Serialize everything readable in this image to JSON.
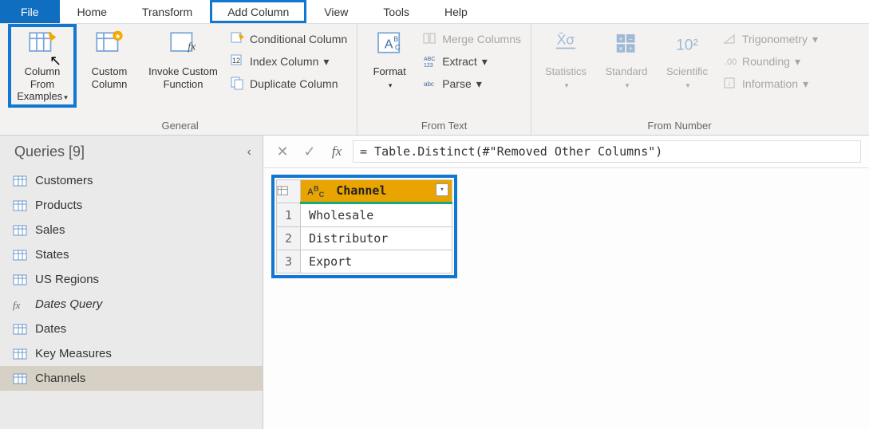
{
  "menu": {
    "file": "File",
    "home": "Home",
    "transform": "Transform",
    "add_column": "Add Column",
    "view": "View",
    "tools": "Tools",
    "help": "Help"
  },
  "ribbon": {
    "general": {
      "label": "General",
      "column_from_examples": "Column From Examples",
      "custom_column": "Custom Column",
      "invoke_custom_function": "Invoke Custom Function",
      "conditional_column": "Conditional Column",
      "index_column": "Index Column",
      "duplicate_column": "Duplicate Column"
    },
    "from_text": {
      "label": "From Text",
      "format": "Format",
      "merge_columns": "Merge Columns",
      "extract": "Extract",
      "parse": "Parse"
    },
    "from_number": {
      "label": "From Number",
      "statistics": "Statistics",
      "standard": "Standard",
      "scientific": "Scientific",
      "trigonometry": "Trigonometry",
      "rounding": "Rounding",
      "information": "Information"
    }
  },
  "sidebar": {
    "title": "Queries [9]",
    "items": [
      {
        "label": "Customers",
        "kind": "table"
      },
      {
        "label": "Products",
        "kind": "table"
      },
      {
        "label": "Sales",
        "kind": "table"
      },
      {
        "label": "States",
        "kind": "table"
      },
      {
        "label": "US Regions",
        "kind": "table"
      },
      {
        "label": "Dates Query",
        "kind": "fx"
      },
      {
        "label": "Dates",
        "kind": "table"
      },
      {
        "label": "Key Measures",
        "kind": "table"
      },
      {
        "label": "Channels",
        "kind": "table",
        "selected": true
      }
    ]
  },
  "formula": "= Table.Distinct(#\"Removed Other Columns\")",
  "grid": {
    "column_header": "Channel",
    "rows": [
      "Wholesale",
      "Distributor",
      "Export"
    ]
  }
}
